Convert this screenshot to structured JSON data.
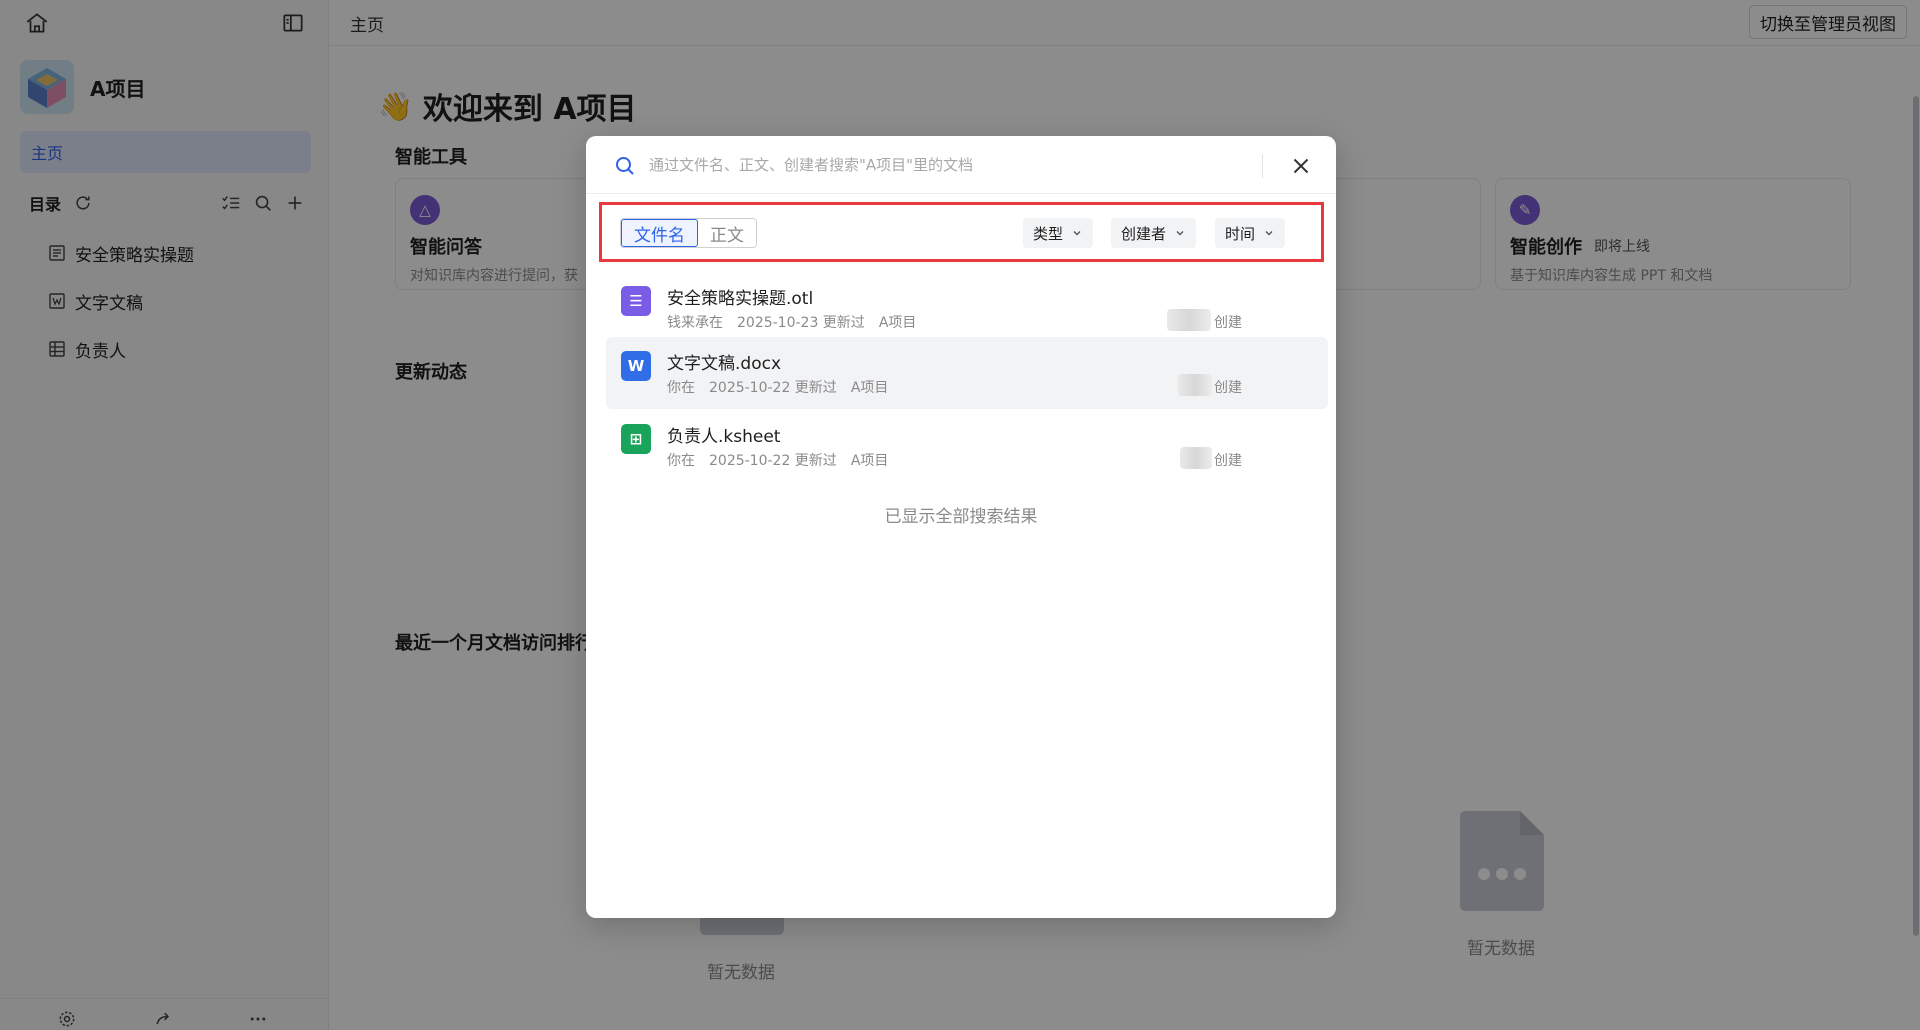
{
  "sidebar": {
    "project_name": "A项目",
    "nav_home": "主页",
    "directory_label": "目录",
    "tree": [
      {
        "label": "安全策略实操题",
        "icon": "outline-doc-icon"
      },
      {
        "label": "文字文稿",
        "icon": "word-doc-icon"
      },
      {
        "label": "负责人",
        "icon": "sheet-icon"
      }
    ]
  },
  "topbar": {
    "breadcrumb": "主页",
    "admin_button": "切换至管理员视图"
  },
  "main": {
    "welcome_emoji": "👋",
    "welcome": "欢迎来到 A项目",
    "smart_tools_title": "智能工具",
    "tools": [
      {
        "name": "智能问答",
        "desc": "对知识库内容进行提问，获",
        "soon": ""
      },
      {
        "name": "智能创作",
        "desc": "基于知识库内容生成 PPT 和文档",
        "soon": "即将上线"
      }
    ],
    "updates_title": "更新动态",
    "ranking_title": "最近一个月文档访问排行",
    "empty_text": "暂无数据"
  },
  "search_dialog": {
    "placeholder": "通过文件名、正文、创建者搜索\"A项目\"里的文档",
    "tabs": {
      "filename": "文件名",
      "content": "正文"
    },
    "filters": {
      "type": "类型",
      "creator": "创建者",
      "time": "时间"
    },
    "results": [
      {
        "name": "安全策略实操题.otl",
        "actor": "钱来承在",
        "date": "2025-10-23 更新过",
        "project": "A项目",
        "created": "创建",
        "icon_color": "#7b5ce6",
        "icon_glyph": "☰"
      },
      {
        "name": "文字文稿.docx",
        "actor": "你在",
        "date": "2025-10-22 更新过",
        "project": "A项目",
        "created": "创建",
        "icon_color": "#2f6ee6",
        "icon_glyph": "W"
      },
      {
        "name": "负责人.ksheet",
        "actor": "你在",
        "date": "2025-10-22 更新过",
        "project": "A项目",
        "created": "创建",
        "icon_color": "#1aa35a",
        "icon_glyph": "⊞"
      }
    ],
    "all_shown": "已显示全部搜索结果"
  }
}
